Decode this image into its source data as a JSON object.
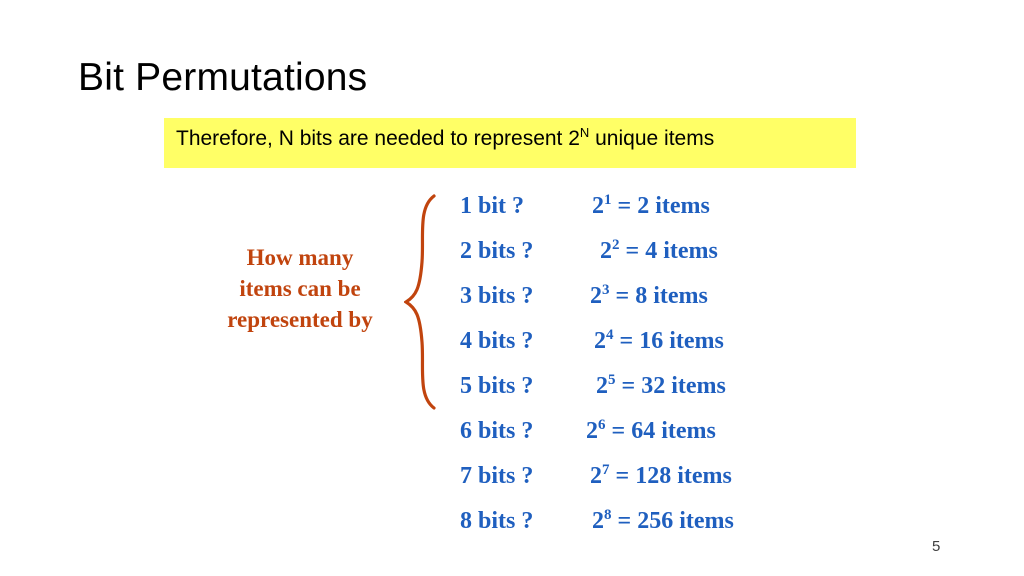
{
  "slide": {
    "title": "Bit Permutations",
    "page_number": "5",
    "banner": {
      "text_before": "Therefore, N bits are needed to represent 2",
      "exponent": "N",
      "text_after": " unique items",
      "background_color": "#ffff66"
    },
    "callout": {
      "lines": [
        "How many",
        "items can be",
        "represented by"
      ],
      "color": "#c1440e"
    },
    "accent_color": "#1f5fbf",
    "rows": [
      {
        "bits_label": "1 bit ?",
        "base": "2",
        "exponent": "1",
        "equals": "=",
        "result": "2 items"
      },
      {
        "bits_label": "2 bits ?",
        "base": "2",
        "exponent": "2",
        "equals": "=",
        "result": "4 items"
      },
      {
        "bits_label": "3 bits ?",
        "base": "2",
        "exponent": "3",
        "equals": "=",
        "result": "8 items"
      },
      {
        "bits_label": "4 bits ?",
        "base": "2",
        "exponent": "4",
        "equals": "=",
        "result": "16 items"
      },
      {
        "bits_label": "5 bits ?",
        "base": "2",
        "exponent": "5",
        "equals": "=",
        "result": "32 items"
      },
      {
        "bits_label": "6 bits ?",
        "base": "2",
        "exponent": "6",
        "equals": "=",
        "result": "64 items"
      },
      {
        "bits_label": "7 bits ?",
        "base": "2",
        "exponent": "7",
        "equals": "=",
        "result": "128 items"
      },
      {
        "bits_label": "8 bits ?",
        "base": "2",
        "exponent": "8",
        "equals": "=",
        "result": "256 items"
      }
    ]
  }
}
